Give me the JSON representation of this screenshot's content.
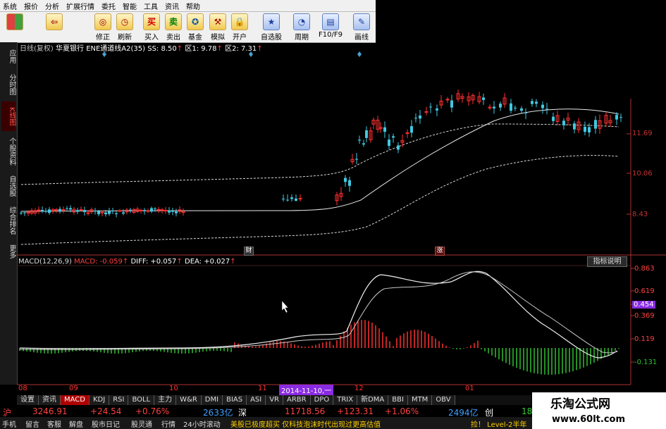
{
  "menu": [
    "系统",
    "报价",
    "分析",
    "扩展行情",
    "委托",
    "智能",
    "工具",
    "资讯",
    "帮助"
  ],
  "toolbar": {
    "buttons": [
      {
        "label": "",
        "icon": "layout-icon"
      },
      {
        "label": "",
        "icon": "back-arrow-icon"
      },
      {
        "label": "修正",
        "icon": "adjust-icon"
      },
      {
        "label": "刷新",
        "icon": "refresh-icon"
      },
      {
        "label": "买入",
        "icon": "buy-icon"
      },
      {
        "label": "卖出",
        "icon": "sell-icon"
      },
      {
        "label": "基金",
        "icon": "fund-icon"
      },
      {
        "label": "模拟",
        "icon": "simulate-icon"
      },
      {
        "label": "开户",
        "icon": "account-icon"
      },
      {
        "label": "自选股",
        "icon": "watchlist-icon"
      },
      {
        "label": "周期",
        "icon": "period-icon"
      },
      {
        "label": "F10/F9",
        "icon": "f10-icon"
      },
      {
        "label": "画线",
        "icon": "draw-icon"
      }
    ],
    "buy_glyph": "买",
    "sell_glyph": "卖"
  },
  "sidebar": [
    "应用",
    "分时图",
    "K线图",
    "个股资料",
    "自选股",
    "综合排名",
    "更多"
  ],
  "chart_header": {
    "period": "日线(复权)",
    "stock": "华夏银行",
    "indicator": "ENE通道线A2(35)",
    "ss": "SS: 8.50",
    "q1": "区1: 9.78",
    "q2": "区2: 7.31"
  },
  "price_axis": [
    "11.69",
    "10.06",
    "8.43"
  ],
  "markers": {
    "cai": "财",
    "zhang": "涨"
  },
  "macd_header": {
    "name": "MACD(12,26,9)",
    "macd": "MACD: -0.059",
    "diff": "DIFF: +0.057",
    "dea": "DEA: +0.027"
  },
  "indicator_button": "指标说明",
  "macd_axis": [
    "0.863",
    "0.619",
    "0.454",
    "0.369",
    "0.119",
    "-0.131"
  ],
  "x_axis": [
    "08",
    "09",
    "10",
    "11",
    "2014-11-10,一",
    "12",
    "01"
  ],
  "tabs": [
    "设置",
    "资讯",
    "MACD",
    "KDJ",
    "RSI",
    "BOLL",
    "主力",
    "W&R",
    "DMI",
    "BIAS",
    "ASI",
    "VR",
    "ARBR",
    "DPO",
    "TRIX",
    "新DMA",
    "BBI",
    "MTM",
    "OBV"
  ],
  "status": {
    "sh_label": "沪",
    "sh_index": "3246.91",
    "sh_change": "+24.54",
    "sh_pct": "+0.76%",
    "sh_amount": "2633亿",
    "sz_label": "深",
    "sz_index": "11718.56",
    "sz_change": "+123.31",
    "sz_pct": "+1.06%",
    "sz_amount": "2494亿",
    "cy_label": "创",
    "cy_index": "18"
  },
  "footer": [
    "手机",
    "留言",
    "客服",
    "解盘",
    "股市日记",
    "股灵通",
    "行情",
    "24小时滚动"
  ],
  "ticker": "美股已极度超买  仅科技泡沫时代出现过更高估值",
  "ticker_right": "捡！ Level-2半年",
  "brand": {
    "name": "乐淘公式网",
    "url": "www.60lt.com"
  },
  "colors": {
    "up": "#ff3030",
    "down": "#40c8e0",
    "bg": "#000000",
    "accent": "#b00000"
  }
}
